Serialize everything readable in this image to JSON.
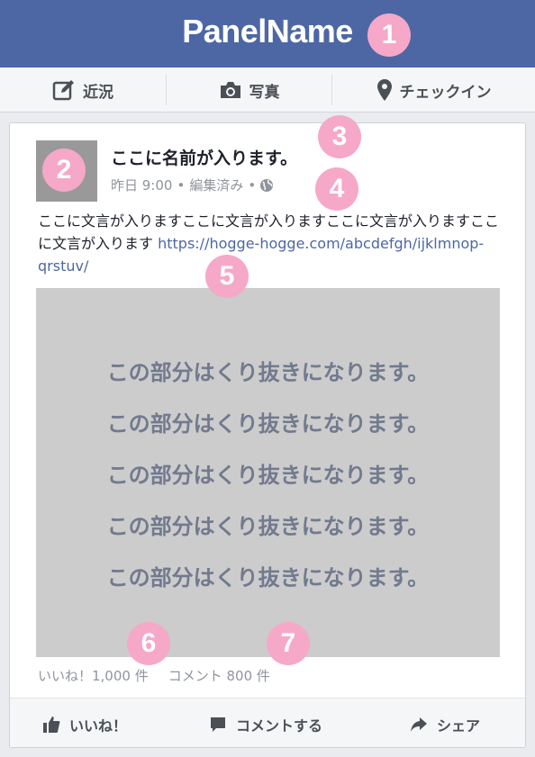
{
  "header": {
    "title": "PanelName"
  },
  "badges": [
    "1",
    "2",
    "3",
    "4",
    "5",
    "6",
    "7"
  ],
  "actions": [
    {
      "label": "近況",
      "icon": "edit-icon"
    },
    {
      "label": "写真",
      "icon": "camera-icon"
    },
    {
      "label": "チェックイン",
      "icon": "location-pin-icon"
    }
  ],
  "post": {
    "name": "ここに名前が入ります。",
    "time": "昨日 9:00",
    "sep": "•",
    "edited": "編集済み",
    "text": "ここに文言が入りますここに文言が入りますここに文言が入りますここに文言が入ります",
    "link": "https://hogge-hogge.com/abcdefgh/ijklmnop-qrstuv/",
    "crop_lines": [
      "この部分はくり抜きになります。",
      "この部分はくり抜きになります。",
      "この部分はくり抜きになります。",
      "この部分はくり抜きになります。",
      "この部分はくり抜きになります。"
    ],
    "likes": "いいね！1,000 件",
    "comments": "コメント 800 件"
  },
  "footer": [
    {
      "label": "いいね！",
      "icon": "thumbs-up-icon"
    },
    {
      "label": "コメントする",
      "icon": "comment-icon"
    },
    {
      "label": "シェア",
      "icon": "share-arrow-icon"
    }
  ],
  "colors": {
    "brand": "#4d67a5",
    "badge": "#f6a8c8",
    "crop_bg": "#cccccc",
    "crop_text": "#717a8e"
  }
}
